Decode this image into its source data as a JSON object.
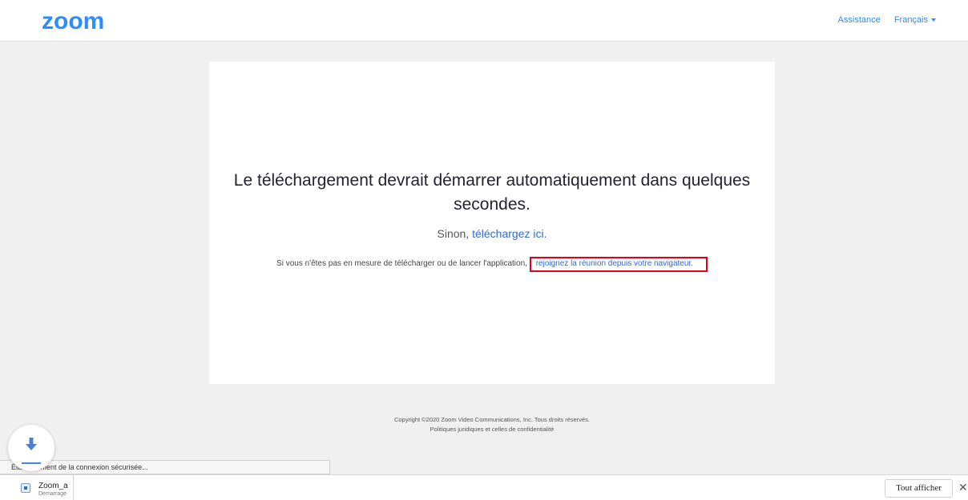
{
  "header": {
    "logo_text": "zoom",
    "assistance": "Assistance",
    "language": "Français"
  },
  "card": {
    "headline": "Le téléchargement devrait démarrer automatiquement dans quelques secondes.",
    "sub_prefix": "Sinon, ",
    "sub_link": "téléchargez ici.",
    "browser_prefix": "Si vous n'êtes pas en mesure de télécharger ou de lancer l'application,",
    "browser_link": "rejoignez la réunion depuis votre navigateur."
  },
  "footer": {
    "copyright": "Copyright ©2020 Zoom Video Communications, Inc. Tous droits réservés.",
    "legal": "Politiques juridiques et celles de confidentialité"
  },
  "status_bubble": {
    "text": "Établissement de la connexion sécurisée..."
  },
  "download_bar": {
    "file_name": "Zoom_a",
    "file_status": "Démarrage",
    "show_all": "Tout afficher",
    "close_glyph": "✕"
  },
  "colors": {
    "brand": "#2d8cff",
    "link": "#2d6bcf",
    "highlight": "#e0001b"
  },
  "icons": [
    "download-icon",
    "file-icon",
    "caret-down-icon",
    "close-icon"
  ]
}
